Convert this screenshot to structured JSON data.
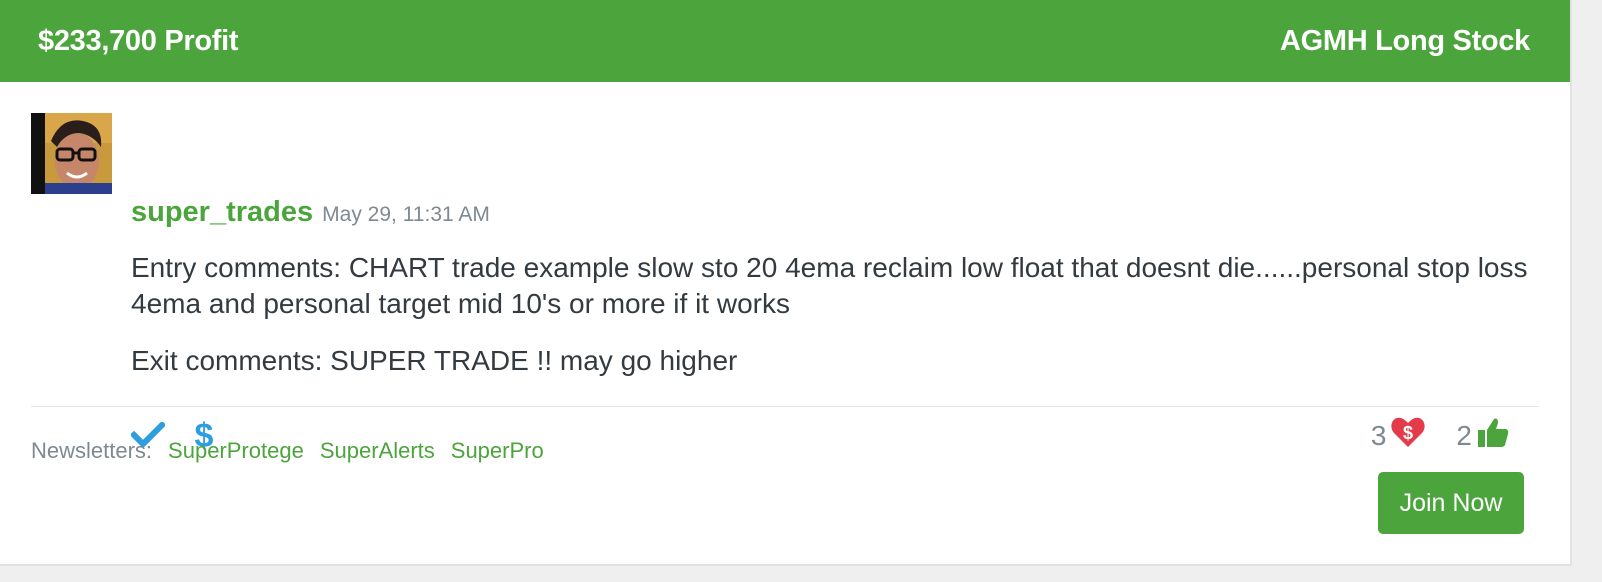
{
  "header": {
    "profit": "$233,700 Profit",
    "trade": "AGMH Long Stock"
  },
  "post": {
    "username": "super_trades",
    "timestamp": "May 29, 11:31 AM",
    "entry_comments": "Entry comments: CHART trade example slow sto 20 4ema reclaim low float that doesnt die......personal stop loss 4ema and personal target mid 10's or more if it works",
    "exit_comments": "Exit comments: SUPER TRADE !! may go higher",
    "actions": {
      "left_icons": [
        "check-icon",
        "dollar-icon"
      ],
      "heart_count": "3",
      "thumbs_count": "2"
    }
  },
  "footer": {
    "newsletters_label": "Newsletters:",
    "newsletters": [
      "SuperProtege",
      "SuperAlerts",
      "SuperPro"
    ],
    "join_label": "Join Now"
  },
  "colors": {
    "brand_green": "#4ca43c",
    "icon_blue": "#2d9ee0",
    "heart_red": "#e43b4a",
    "muted_text": "#7d8a93"
  }
}
